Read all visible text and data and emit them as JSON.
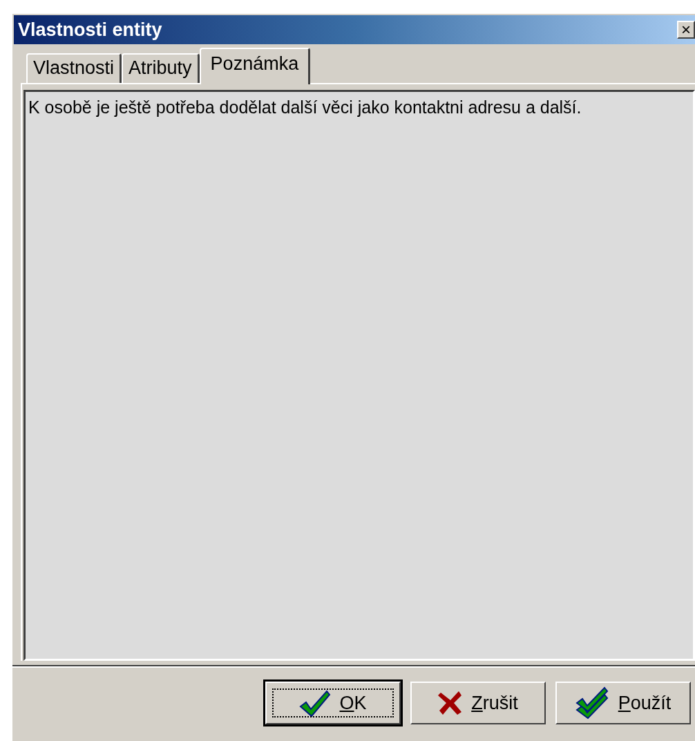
{
  "window": {
    "title": "Vlastnosti entity",
    "close": "×"
  },
  "tabs": [
    {
      "label": "Vlastnosti",
      "selected": false
    },
    {
      "label": "Atributy",
      "selected": false
    },
    {
      "label": "Poznámka",
      "selected": true
    }
  ],
  "note": {
    "value": "K osobě je ještě potřeba dodělat další věci jako kontaktni adresu a další."
  },
  "buttons": [
    {
      "kind": "ok",
      "label": "OK",
      "mnemonic_underlined": true,
      "focused": true
    },
    {
      "kind": "cancel",
      "label": "Zrušit",
      "mnemonic_underlined": true,
      "focused": false
    },
    {
      "kind": "apply",
      "label": "Použít",
      "mnemonic_underlined": true,
      "focused": false
    }
  ]
}
